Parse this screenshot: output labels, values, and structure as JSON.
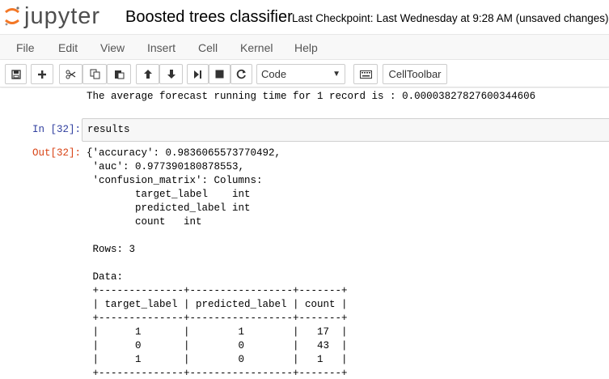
{
  "header": {
    "logo_text": "jupyter",
    "notebook_title": "Boosted trees classifier",
    "checkpoint": "Last Checkpoint: Last Wednesday at 9:28 AM (unsaved changes)"
  },
  "menubar": {
    "items": [
      "File",
      "Edit",
      "View",
      "Insert",
      "Cell",
      "Kernel",
      "Help"
    ]
  },
  "toolbar": {
    "cell_type": "Code",
    "celltoolbar_label": "CellToolbar",
    "icons": [
      "save-icon",
      "plus-icon",
      "cut-icon",
      "copy-icon",
      "paste-icon",
      "arrow-up-icon",
      "arrow-down-icon",
      "step-forward-icon",
      "stop-icon",
      "refresh-icon",
      "keyboard-icon"
    ]
  },
  "cells": {
    "prev_output": "The average forecast running time for 1 record is : 0.00003827827600344606",
    "in_prompt": "In [32]:",
    "in_code": "results",
    "out_prompt": "Out[32]:",
    "out_lines": [
      "{'accuracy': 0.9836065573770492,",
      " 'auc': 0.977390180878553,",
      " 'confusion_matrix': Columns:",
      "        target_label    int",
      "        predicted_label int",
      "        count   int",
      "",
      " Rows: 3",
      "",
      " Data:",
      " +--------------+-----------------+-------+",
      " | target_label | predicted_label | count |",
      " +--------------+-----------------+-------+",
      " |      1       |        1        |   17  |",
      " |      0       |        0        |   43  |",
      " |      1       |        0        |   1   |",
      " +--------------+-----------------+-------+"
    ]
  }
}
